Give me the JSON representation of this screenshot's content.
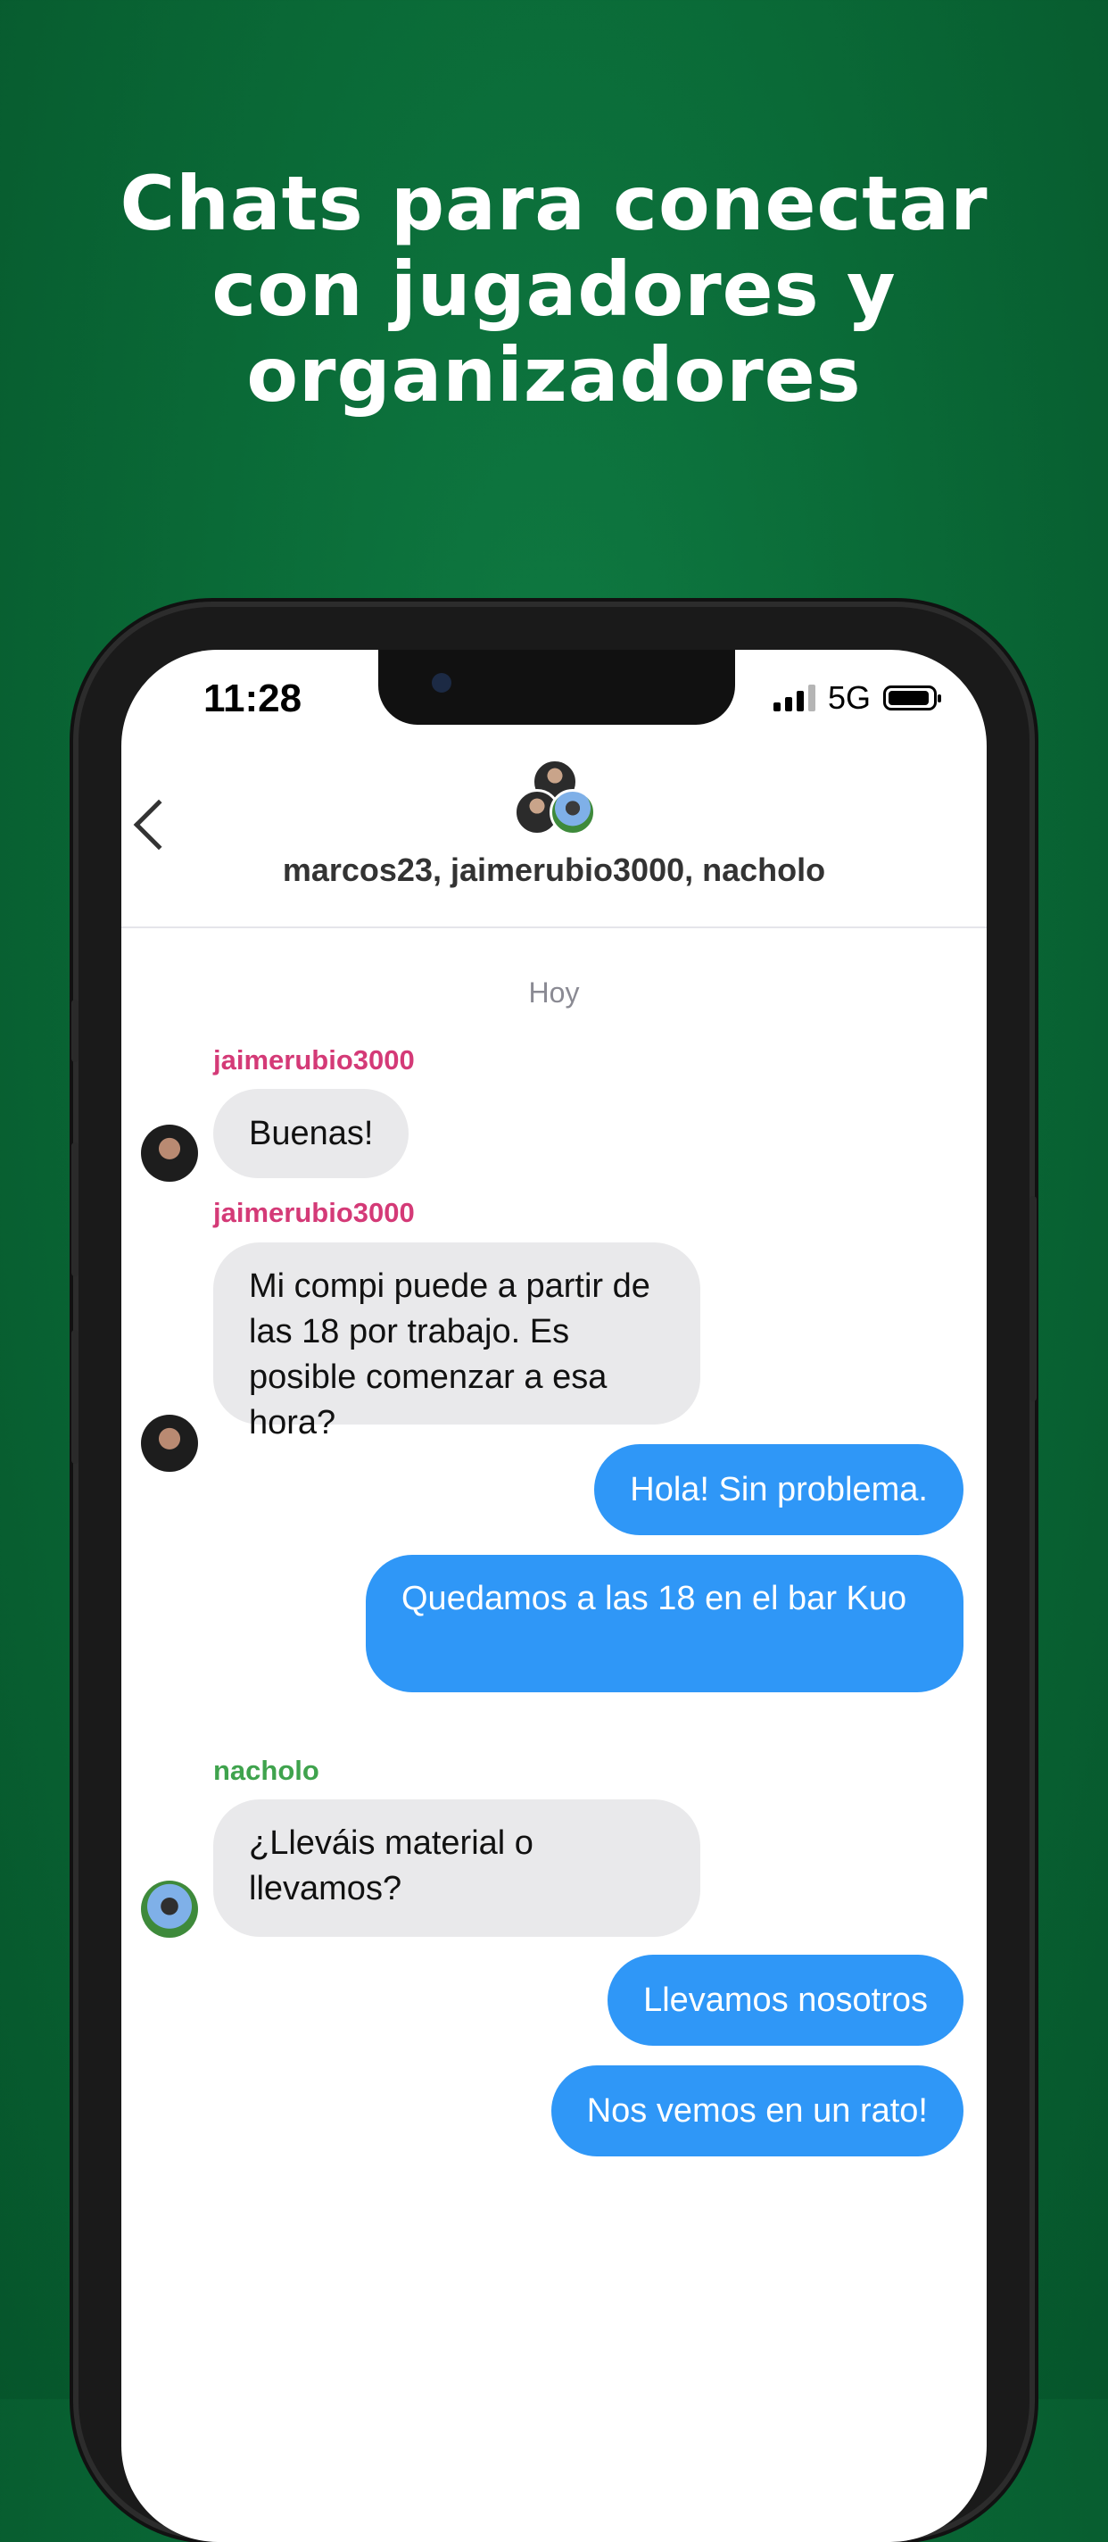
{
  "headline": {
    "line1": "Chats para conectar",
    "line2": "con jugadores y",
    "line3": "organizadores"
  },
  "status_bar": {
    "time": "11:28",
    "network": "5G"
  },
  "chat": {
    "title": "marcos23, jaimerubio3000, nacholo",
    "date_label": "Hoy",
    "messages": [
      {
        "sender": "jaimerubio3000",
        "text": "Buenas!",
        "direction": "incoming"
      },
      {
        "sender": "jaimerubio3000",
        "text": "Mi compi puede a partir de las 18 por trabajo. Es posible comenzar a esa hora?",
        "direction": "incoming"
      },
      {
        "text": "Hola! Sin problema.",
        "direction": "outgoing"
      },
      {
        "text": "Quedamos a las 18 en el bar Kuo",
        "direction": "outgoing"
      },
      {
        "sender": "nacholo",
        "text": "¿Lleváis material o llevamos?",
        "direction": "incoming"
      },
      {
        "text": "Llevamos nosotros",
        "direction": "outgoing"
      },
      {
        "text": "Nos vemos en un rato!",
        "direction": "outgoing"
      }
    ]
  },
  "colors": {
    "background": "#0a6a37",
    "outgoing_bubble": "#2f97f7",
    "incoming_bubble": "#e9e9eb",
    "sender_pink": "#d43a77",
    "sender_green": "#3fa34d"
  }
}
